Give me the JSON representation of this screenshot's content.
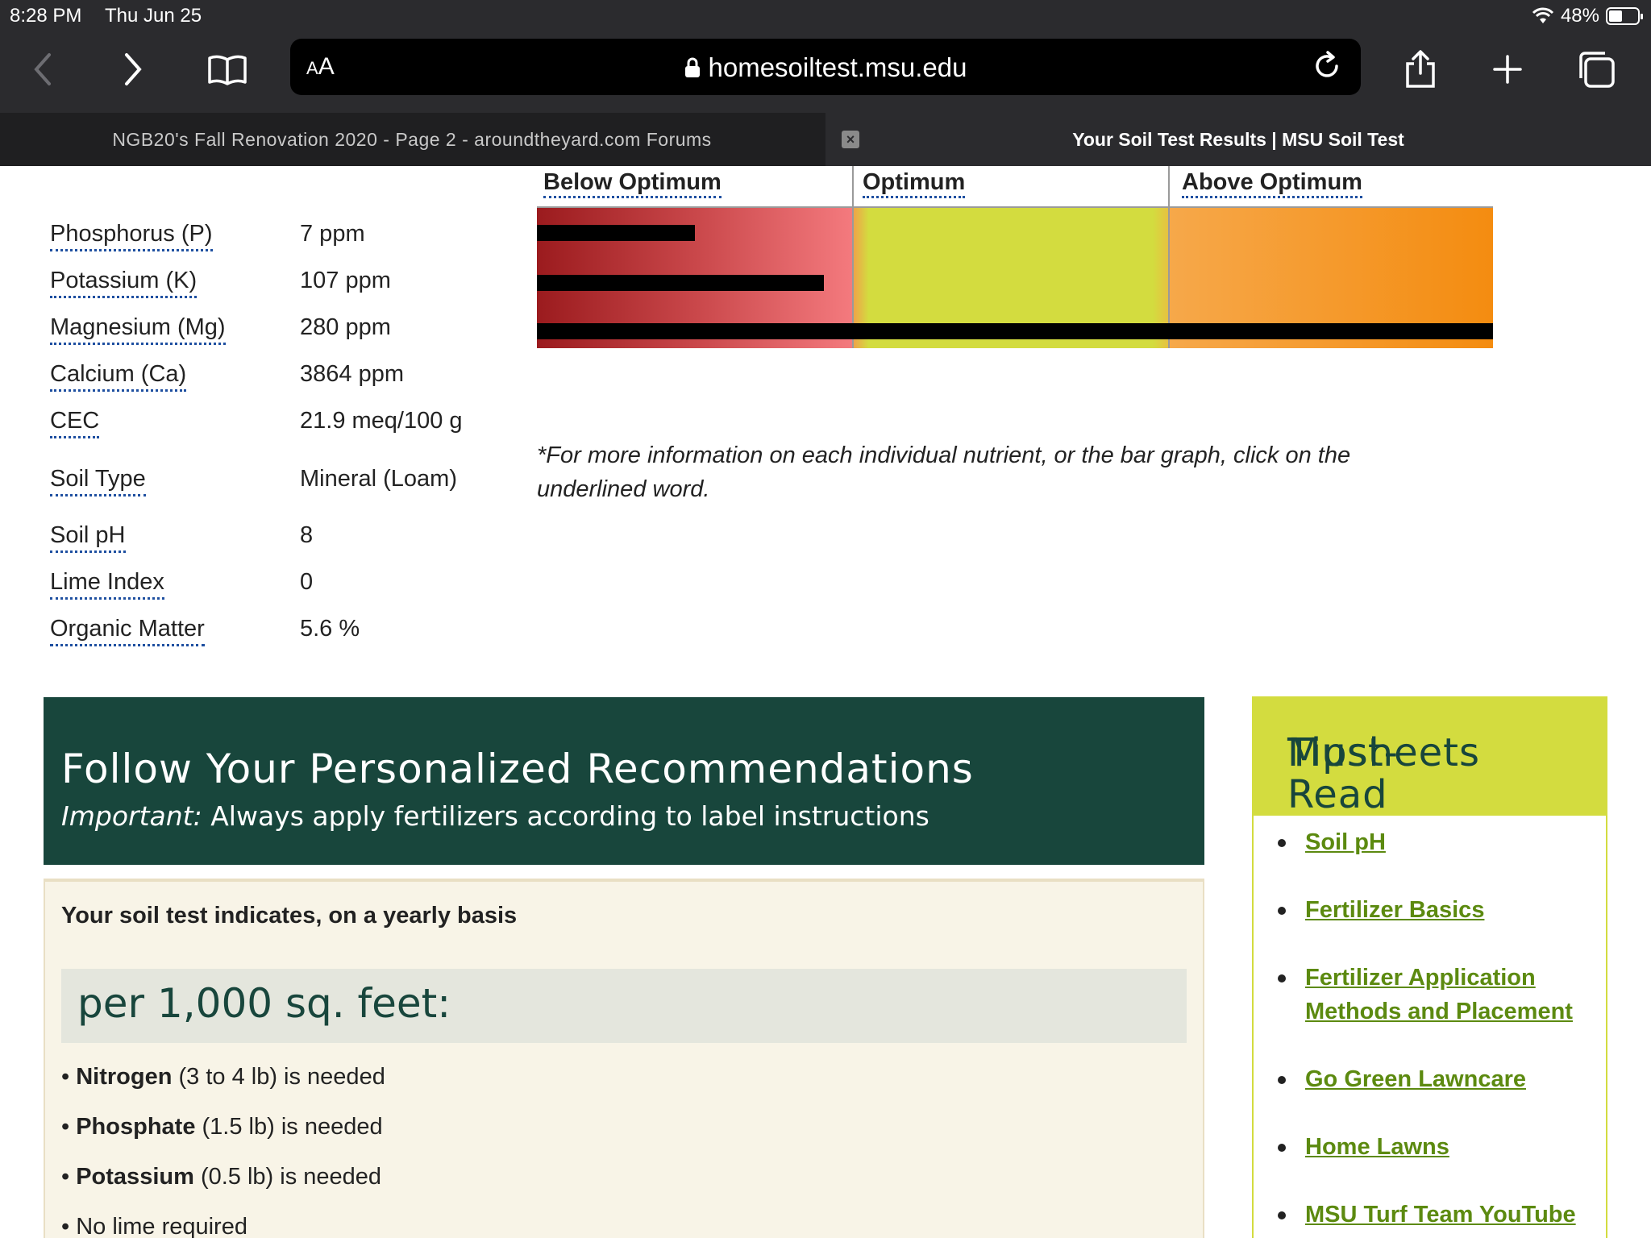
{
  "status": {
    "time": "8:28 PM",
    "date": "Thu Jun 25",
    "battery": "48%",
    "battery_level": 0.48
  },
  "browser": {
    "url": "homesoiltest.msu.edu",
    "aa_label_small": "A",
    "aa_label": "A",
    "tabs": [
      {
        "title": "NGB20's Fall Renovation 2020 - Page 2 - aroundtheyard.com Forums"
      },
      {
        "title": "Your Soil Test Results | MSU Soil Test"
      }
    ]
  },
  "nutrients": [
    {
      "name": "Phosphorus (P)",
      "value": "7 ppm"
    },
    {
      "name": "Potassium (K)",
      "value": "107 ppm"
    },
    {
      "name": "Magnesium (Mg)",
      "value": "280 ppm"
    },
    {
      "name": "Calcium (Ca)",
      "value": "3864 ppm"
    },
    {
      "name": "CEC",
      "value": "21.9 meq/100 g"
    },
    {
      "name": "Soil Type",
      "value": "Mineral (Loam)"
    },
    {
      "name": "Soil pH",
      "value": "8"
    },
    {
      "name": "Lime Index",
      "value": "0"
    },
    {
      "name": "Organic Matter",
      "value": "5.6 %"
    }
  ],
  "chart_data": {
    "type": "bar",
    "orientation": "horizontal",
    "zones": [
      "Below Optimum",
      "Optimum",
      "Above Optimum"
    ],
    "zone_colors": [
      "#c9474a",
      "#d3dc3f",
      "#f48c10"
    ],
    "bars": [
      {
        "name": "Phosphorus (P)",
        "level": 0.165
      },
      {
        "name": "Potassium (K)",
        "level": 0.3
      },
      {
        "name": "Magnesium (Mg)",
        "level": 1.0
      }
    ],
    "footnote": "*For more information on each individual nutrient, or the bar graph, click on the underlined word."
  },
  "recommendations": {
    "title": "Follow Your Personalized Recommendations",
    "important_label": "Important:",
    "important_text": " Always apply fertilizers according to label instructions",
    "intro": "Your soil test indicates, on a yearly basis",
    "per_area": "per 1,000 sq. feet:",
    "items": [
      {
        "bold": "Nitrogen",
        "text": " (3 to 4 lb) is needed"
      },
      {
        "bold": "Phosphate",
        "text": " (1.5 lb) is needed"
      },
      {
        "bold": "Potassium",
        "text": " (0.5 lb) is needed"
      },
      {
        "bold": "",
        "text": "No lime required"
      }
    ]
  },
  "tipsheets": {
    "title_line1": "Must-Read",
    "title_line2": "Tipsheets",
    "links": [
      "Soil pH",
      "Fertilizer Basics",
      "Fertilizer Application Methods and Placement",
      "Go Green Lawncare",
      "Home Lawns",
      "MSU Turf Team YouTube"
    ]
  },
  "colors": {
    "brand_green": "#18463c",
    "accent_lime": "#d3dc3f",
    "link_green": "#5c8a10"
  }
}
